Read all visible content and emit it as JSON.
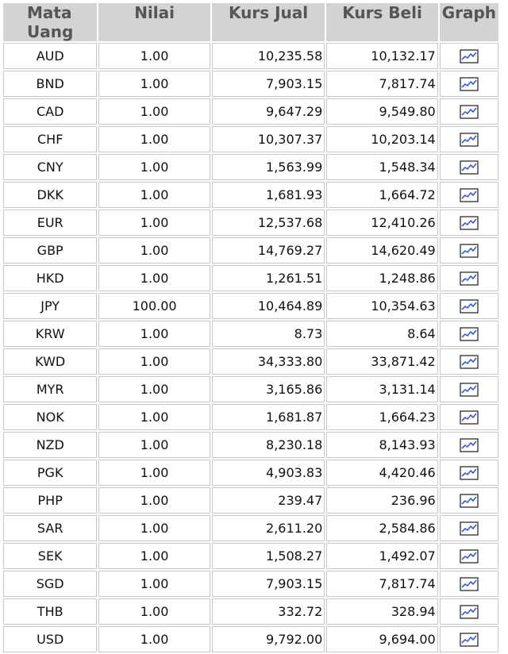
{
  "table": {
    "headers": {
      "mata_uang": "Mata Uang",
      "nilai": "Nilai",
      "kurs_jual": "Kurs Jual",
      "kurs_beli": "Kurs Beli",
      "graph": "Graph"
    },
    "graph_icon": "line-chart-icon",
    "rows": [
      {
        "currency": "AUD",
        "nilai": "1.00",
        "jual": "10,235.58",
        "beli": "10,132.17"
      },
      {
        "currency": "BND",
        "nilai": "1.00",
        "jual": "7,903.15",
        "beli": "7,817.74"
      },
      {
        "currency": "CAD",
        "nilai": "1.00",
        "jual": "9,647.29",
        "beli": "9,549.80"
      },
      {
        "currency": "CHF",
        "nilai": "1.00",
        "jual": "10,307.37",
        "beli": "10,203.14"
      },
      {
        "currency": "CNY",
        "nilai": "1.00",
        "jual": "1,563.99",
        "beli": "1,548.34"
      },
      {
        "currency": "DKK",
        "nilai": "1.00",
        "jual": "1,681.93",
        "beli": "1,664.72"
      },
      {
        "currency": "EUR",
        "nilai": "1.00",
        "jual": "12,537.68",
        "beli": "12,410.26"
      },
      {
        "currency": "GBP",
        "nilai": "1.00",
        "jual": "14,769.27",
        "beli": "14,620.49"
      },
      {
        "currency": "HKD",
        "nilai": "1.00",
        "jual": "1,261.51",
        "beli": "1,248.86"
      },
      {
        "currency": "JPY",
        "nilai": "100.00",
        "jual": "10,464.89",
        "beli": "10,354.63"
      },
      {
        "currency": "KRW",
        "nilai": "1.00",
        "jual": "8.73",
        "beli": "8.64"
      },
      {
        "currency": "KWD",
        "nilai": "1.00",
        "jual": "34,333.80",
        "beli": "33,871.42"
      },
      {
        "currency": "MYR",
        "nilai": "1.00",
        "jual": "3,165.86",
        "beli": "3,131.14"
      },
      {
        "currency": "NOK",
        "nilai": "1.00",
        "jual": "1,681.87",
        "beli": "1,664.23"
      },
      {
        "currency": "NZD",
        "nilai": "1.00",
        "jual": "8,230.18",
        "beli": "8,143.93"
      },
      {
        "currency": "PGK",
        "nilai": "1.00",
        "jual": "4,903.83",
        "beli": "4,420.46"
      },
      {
        "currency": "PHP",
        "nilai": "1.00",
        "jual": "239.47",
        "beli": "236.96"
      },
      {
        "currency": "SAR",
        "nilai": "1.00",
        "jual": "2,611.20",
        "beli": "2,584.86"
      },
      {
        "currency": "SEK",
        "nilai": "1.00",
        "jual": "1,508.27",
        "beli": "1,492.07"
      },
      {
        "currency": "SGD",
        "nilai": "1.00",
        "jual": "7,903.15",
        "beli": "7,817.74"
      },
      {
        "currency": "THB",
        "nilai": "1.00",
        "jual": "332.72",
        "beli": "328.94"
      },
      {
        "currency": "USD",
        "nilai": "1.00",
        "jual": "9,792.00",
        "beli": "9,694.00"
      }
    ]
  },
  "colors": {
    "header_bg": "#d3d3d3",
    "header_text": "#555555",
    "cell_border": "#c8c8c8",
    "icon_line": "#3b5bd6"
  }
}
